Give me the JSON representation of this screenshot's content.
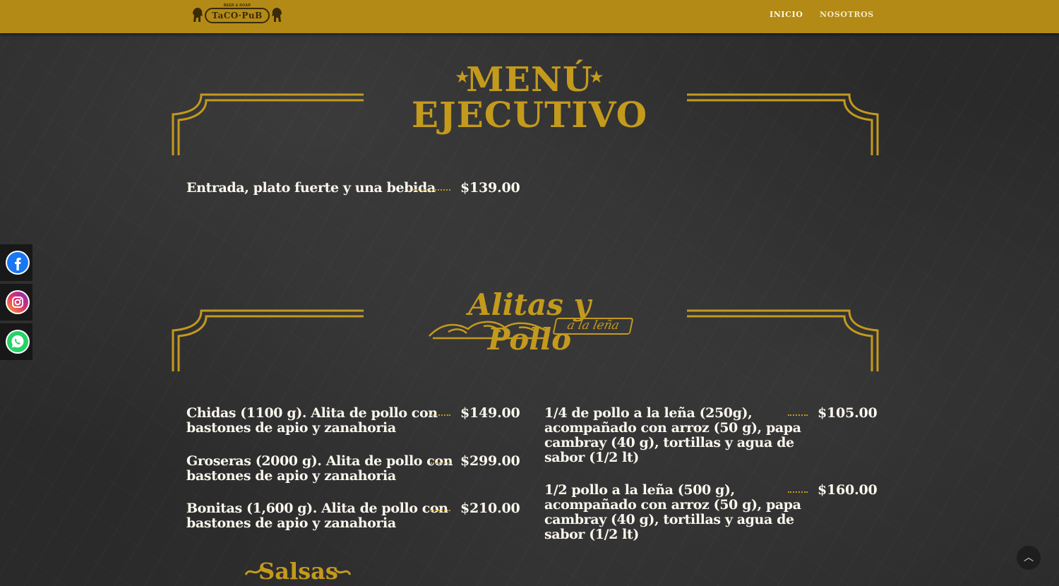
{
  "header": {
    "logo_text": "TaCO·PuB",
    "logo_tagline": "BEER & ROAR",
    "nav": [
      {
        "label": "INICIO"
      },
      {
        "label": "NOSOTROS"
      }
    ]
  },
  "menu_ejecutivo": {
    "title_line1": "MENÚ",
    "title_line2": "EJECUTIVO",
    "items": [
      {
        "description": "Entrada, plato fuerte y una bebida",
        "price": "$139.00"
      }
    ]
  },
  "alitas": {
    "title": "Alitas y Pollo",
    "subtitle": "a la leña",
    "left_items": [
      {
        "line1": "Chidas (1100 g). Alita de pollo con",
        "line2": "bastones de apio y zanahoria",
        "price": "$149.00"
      },
      {
        "line1": "Groseras (2000 g). Alita de pollo con",
        "line2": "bastones de apio y zanahoria",
        "price": "$299.00"
      },
      {
        "line1": "Bonitas (1,600 g). Alita de pollo con",
        "line2": "bastones de apio y zanahoria",
        "price": "$210.00"
      }
    ],
    "right_items": [
      {
        "line1": "1/4 de pollo a la leña (250g),",
        "line2": "acompañado con arroz (50 g), papa",
        "line3": "cambray (40 g), tortillas y agua de",
        "line4": "sabor (1/2 lt)",
        "price": "$105.00"
      },
      {
        "line1": "1/2 pollo a la leña (500 g),",
        "line2": "acompañado con arroz (50 g), papa",
        "line3": "cambray (40 g), tortillas y agua de",
        "line4": "sabor (1/2 lt)",
        "price": "$160.00"
      }
    ]
  },
  "salsas": {
    "title": "Salsas"
  },
  "social": [
    {
      "icon": "facebook-icon"
    },
    {
      "icon": "instagram-icon"
    },
    {
      "icon": "whatsapp-icon"
    }
  ],
  "scroll_top_icon": "chevron-up-icon",
  "colors": {
    "header_gold": "#b38a15",
    "accent_gold": "#c49a1d",
    "chalkboard": "#2a2a2a"
  }
}
